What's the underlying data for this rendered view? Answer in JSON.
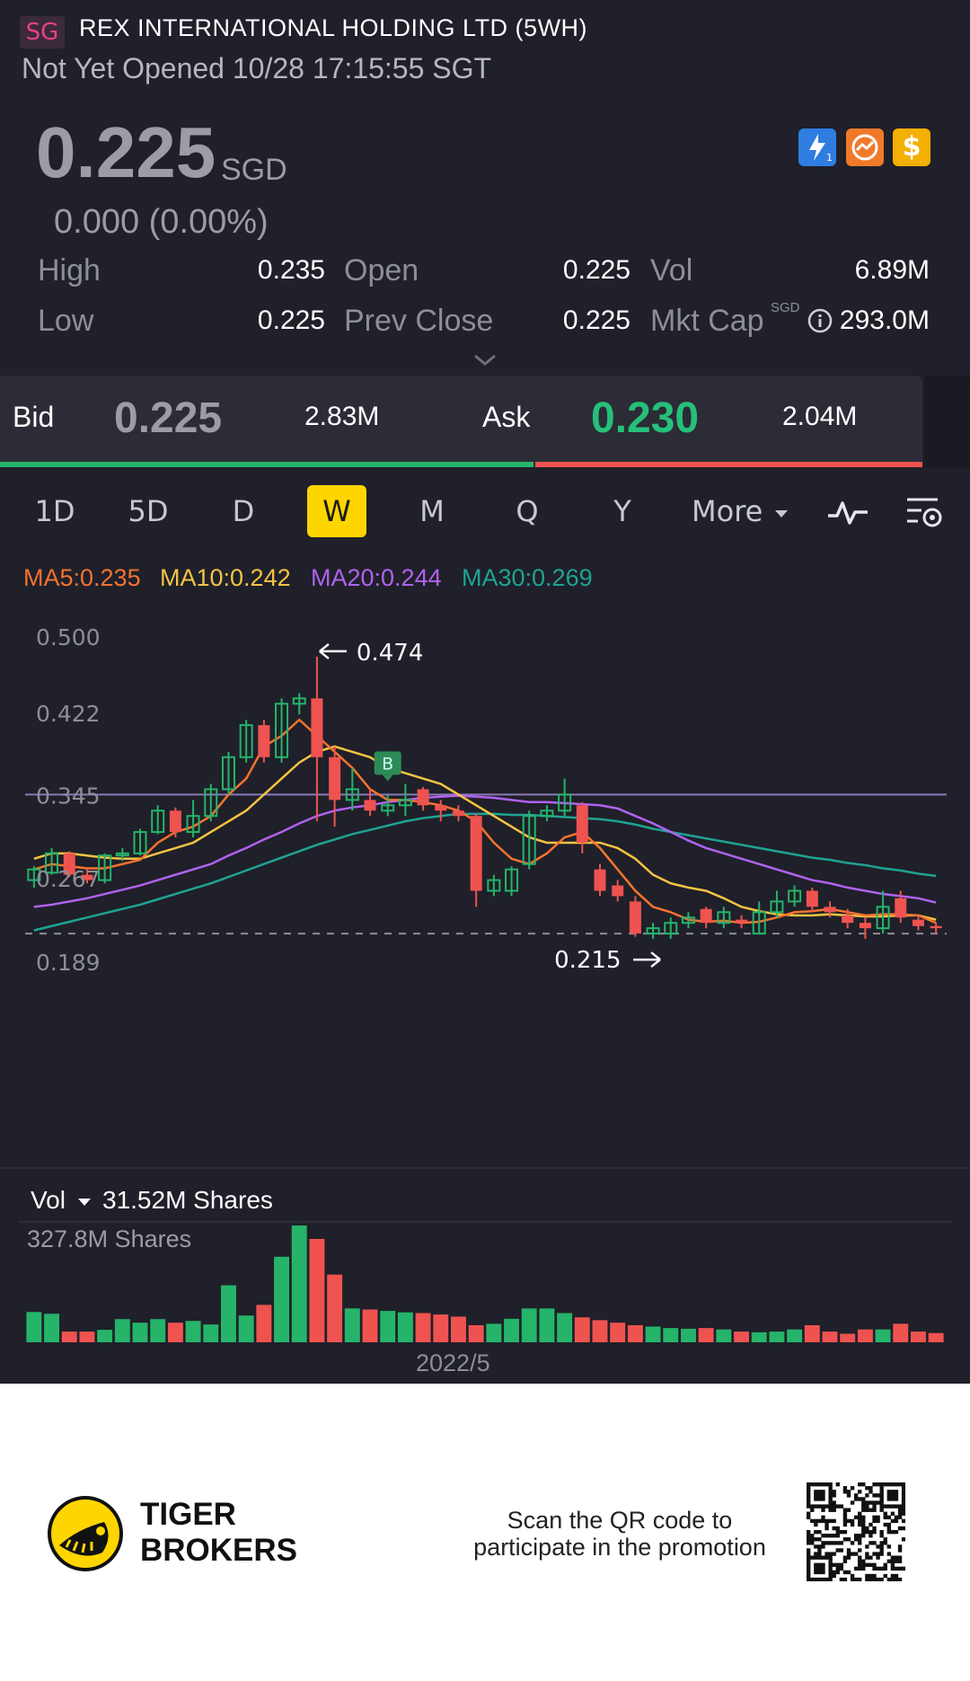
{
  "header": {
    "market_badge": "SG",
    "title": "REX INTERNATIONAL HOLDING LTD (5WH)",
    "status": "Not Yet Opened 10/28 17:15:55 SGT"
  },
  "quote": {
    "price": "0.225",
    "currency": "SGD",
    "change": "0.000 (0.00%)",
    "badges": [
      "lightning-level1-icon",
      "orange-chart-icon",
      "dollar-icon"
    ],
    "high_label": "High",
    "high_value": "0.235",
    "low_label": "Low",
    "low_value": "0.225",
    "open_label": "Open",
    "open_value": "0.225",
    "prev_close_label": "Prev Close",
    "prev_close_value": "0.225",
    "vol_label": "Vol",
    "vol_value": "6.89M",
    "mkt_cap_label": "Mkt Cap",
    "mkt_cap_unit": "SGD",
    "mkt_cap_value": "293.0M"
  },
  "bidask": {
    "bid_label": "Bid",
    "bid_price": "0.225",
    "bid_size": "2.83M",
    "ask_label": "Ask",
    "ask_price": "0.230",
    "ask_size": "2.04M",
    "bid_fraction": 0.58
  },
  "tabs": [
    "1D",
    "5D",
    "D",
    "W",
    "M",
    "Q",
    "Y",
    "More"
  ],
  "active_tab": "W",
  "ma_legend": {
    "ma5": "MA5:0.235",
    "ma10": "MA10:0.242",
    "ma20": "MA20:0.244",
    "ma30": "MA30:0.269"
  },
  "colors": {
    "up": "#25b46a",
    "down": "#ef5350",
    "ma5": "#f5732f",
    "ma10": "#f6c343",
    "ma20": "#b062f0",
    "ma30": "#1fa394"
  },
  "chart_data": {
    "type": "candlestick",
    "y_ticks": [
      "0.500",
      "0.422",
      "0.345",
      "0.267",
      "0.189"
    ],
    "ylim": [
      0.189,
      0.5
    ],
    "high_annotation": "0.474",
    "low_annotation": "0.215",
    "buy_marker": "B",
    "reference_line": 0.345,
    "x_label": "2022/5",
    "candles": [
      [
        0.265,
        0.275,
        0.258,
        0.278
      ],
      [
        0.272,
        0.29,
        0.27,
        0.295
      ],
      [
        0.29,
        0.27,
        0.268,
        0.292
      ],
      [
        0.27,
        0.265,
        0.262,
        0.275
      ],
      [
        0.265,
        0.288,
        0.262,
        0.29
      ],
      [
        0.288,
        0.29,
        0.283,
        0.295
      ],
      [
        0.29,
        0.31,
        0.288,
        0.313
      ],
      [
        0.31,
        0.33,
        0.308,
        0.335
      ],
      [
        0.33,
        0.31,
        0.305,
        0.333
      ],
      [
        0.31,
        0.325,
        0.305,
        0.34
      ],
      [
        0.325,
        0.35,
        0.32,
        0.355
      ],
      [
        0.35,
        0.38,
        0.345,
        0.385
      ],
      [
        0.38,
        0.41,
        0.375,
        0.415
      ],
      [
        0.41,
        0.38,
        0.375,
        0.415
      ],
      [
        0.38,
        0.43,
        0.375,
        0.435
      ],
      [
        0.43,
        0.435,
        0.42,
        0.44
      ],
      [
        0.435,
        0.38,
        0.32,
        0.474
      ],
      [
        0.38,
        0.34,
        0.315,
        0.39
      ],
      [
        0.34,
        0.35,
        0.33,
        0.37
      ],
      [
        0.34,
        0.33,
        0.325,
        0.35
      ],
      [
        0.33,
        0.335,
        0.325,
        0.345
      ],
      [
        0.335,
        0.34,
        0.325,
        0.355
      ],
      [
        0.35,
        0.335,
        0.33,
        0.352
      ],
      [
        0.335,
        0.33,
        0.32,
        0.34
      ],
      [
        0.33,
        0.325,
        0.32,
        0.335
      ],
      [
        0.325,
        0.255,
        0.24,
        0.327
      ],
      [
        0.255,
        0.265,
        0.25,
        0.27
      ],
      [
        0.255,
        0.275,
        0.25,
        0.278
      ],
      [
        0.28,
        0.325,
        0.275,
        0.33
      ],
      [
        0.325,
        0.33,
        0.32,
        0.335
      ],
      [
        0.33,
        0.345,
        0.325,
        0.36
      ],
      [
        0.335,
        0.3,
        0.29,
        0.338
      ],
      [
        0.275,
        0.255,
        0.25,
        0.28
      ],
      [
        0.26,
        0.25,
        0.245,
        0.265
      ],
      [
        0.245,
        0.215,
        0.212,
        0.25
      ],
      [
        0.215,
        0.22,
        0.21,
        0.225
      ],
      [
        0.215,
        0.225,
        0.21,
        0.23
      ],
      [
        0.225,
        0.23,
        0.22,
        0.235
      ],
      [
        0.238,
        0.225,
        0.22,
        0.24
      ],
      [
        0.225,
        0.235,
        0.22,
        0.24
      ],
      [
        0.228,
        0.225,
        0.22,
        0.232
      ],
      [
        0.215,
        0.235,
        0.215,
        0.245
      ],
      [
        0.235,
        0.245,
        0.23,
        0.255
      ],
      [
        0.245,
        0.255,
        0.24,
        0.26
      ],
      [
        0.255,
        0.24,
        0.235,
        0.258
      ],
      [
        0.24,
        0.235,
        0.23,
        0.245
      ],
      [
        0.232,
        0.225,
        0.22,
        0.238
      ],
      [
        0.225,
        0.22,
        0.21,
        0.23
      ],
      [
        0.22,
        0.24,
        0.215,
        0.255
      ],
      [
        0.248,
        0.23,
        0.225,
        0.255
      ],
      [
        0.228,
        0.222,
        0.218,
        0.232
      ],
      [
        0.222,
        0.22,
        0.215,
        0.225
      ]
    ],
    "ma5": [
      0.275,
      0.28,
      0.278,
      0.276,
      0.276,
      0.28,
      0.284,
      0.3,
      0.31,
      0.315,
      0.325,
      0.345,
      0.36,
      0.39,
      0.4,
      0.415,
      0.4,
      0.385,
      0.37,
      0.35,
      0.34,
      0.34,
      0.338,
      0.335,
      0.33,
      0.32,
      0.3,
      0.285,
      0.28,
      0.29,
      0.305,
      0.31,
      0.295,
      0.275,
      0.255,
      0.24,
      0.235,
      0.228,
      0.226,
      0.227,
      0.225,
      0.226,
      0.23,
      0.235,
      0.236,
      0.238,
      0.235,
      0.232,
      0.233,
      0.233,
      0.232,
      0.225
    ],
    "ma10": [
      0.285,
      0.29,
      0.29,
      0.288,
      0.286,
      0.285,
      0.285,
      0.29,
      0.295,
      0.3,
      0.31,
      0.32,
      0.33,
      0.345,
      0.36,
      0.375,
      0.385,
      0.39,
      0.385,
      0.38,
      0.37,
      0.365,
      0.36,
      0.355,
      0.345,
      0.335,
      0.325,
      0.315,
      0.305,
      0.3,
      0.3,
      0.3,
      0.3,
      0.295,
      0.285,
      0.27,
      0.262,
      0.258,
      0.255,
      0.248,
      0.24,
      0.236,
      0.233,
      0.232,
      0.232,
      0.233,
      0.232,
      0.231,
      0.231,
      0.232,
      0.232,
      0.228
    ],
    "ma20": [
      0.24,
      0.242,
      0.245,
      0.248,
      0.252,
      0.256,
      0.26,
      0.265,
      0.27,
      0.275,
      0.28,
      0.288,
      0.295,
      0.303,
      0.31,
      0.318,
      0.325,
      0.33,
      0.333,
      0.335,
      0.338,
      0.34,
      0.342,
      0.343,
      0.344,
      0.343,
      0.342,
      0.34,
      0.338,
      0.338,
      0.337,
      0.336,
      0.335,
      0.332,
      0.325,
      0.318,
      0.31,
      0.302,
      0.295,
      0.29,
      0.285,
      0.28,
      0.275,
      0.27,
      0.265,
      0.262,
      0.258,
      0.255,
      0.252,
      0.25,
      0.248,
      0.244
    ],
    "ma30": [
      0.218,
      0.222,
      0.226,
      0.23,
      0.234,
      0.238,
      0.242,
      0.247,
      0.252,
      0.257,
      0.262,
      0.268,
      0.274,
      0.28,
      0.286,
      0.292,
      0.298,
      0.303,
      0.308,
      0.312,
      0.316,
      0.32,
      0.323,
      0.325,
      0.327,
      0.327,
      0.327,
      0.326,
      0.326,
      0.325,
      0.324,
      0.323,
      0.322,
      0.32,
      0.317,
      0.313,
      0.31,
      0.307,
      0.304,
      0.301,
      0.298,
      0.295,
      0.292,
      0.289,
      0.286,
      0.284,
      0.281,
      0.279,
      0.276,
      0.274,
      0.271,
      0.269
    ]
  },
  "volume": {
    "label": "Vol",
    "summary": "31.52M Shares",
    "max_label": "327.8M Shares",
    "max_value": 327.8,
    "bars": [
      85,
      80,
      30,
      30,
      35,
      65,
      55,
      65,
      55,
      60,
      50,
      160,
      75,
      105,
      240,
      327.8,
      290,
      190,
      95,
      92,
      88,
      84,
      82,
      78,
      72,
      48,
      52,
      66,
      95,
      95,
      82,
      70,
      62,
      55,
      48,
      44,
      40,
      38,
      40,
      36,
      30,
      28,
      30,
      36,
      48,
      30,
      24,
      36,
      36,
      52,
      30,
      26
    ]
  },
  "footer": {
    "brand_line1": "TIGER",
    "brand_line2": "BROKERS",
    "promo_line1": "Scan the QR code to",
    "promo_line2": "participate in the promotion"
  }
}
